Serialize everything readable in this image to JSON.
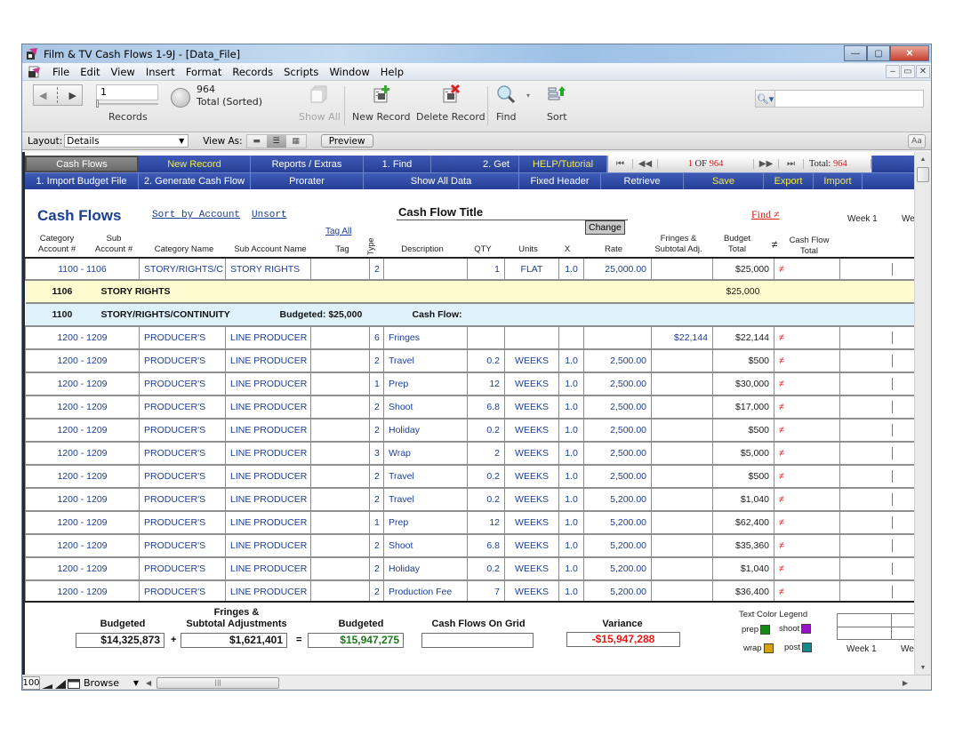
{
  "window": {
    "title": "Film & TV Cash Flows 1-9J - [Data_File]",
    "controls": {
      "minimize": "—",
      "maximize": "▢",
      "close": "✕"
    }
  },
  "menu": [
    "File",
    "Edit",
    "View",
    "Insert",
    "Format",
    "Records",
    "Scripts",
    "Window",
    "Help"
  ],
  "mdi_controls": {
    "minimize": "–",
    "restore": "🗗",
    "close": "✕"
  },
  "toolbar": {
    "record_value": "1",
    "records_label": "Records",
    "found_count": "964",
    "found_status": "Total (Sorted)",
    "show_all": "Show All",
    "new_record": "New Record",
    "delete_record": "Delete Record",
    "find": "Find",
    "sort": "Sort",
    "quick_find_placeholder": ""
  },
  "layout_bar": {
    "layout_label": "Layout:",
    "layout_value": "Details",
    "view_as_label": "View As:",
    "preview": "Preview",
    "text_format": "Aa"
  },
  "nav_row1": {
    "cash_flows": "Cash Flows",
    "new_record": "New  Record",
    "reports": "Reports / Extras",
    "find": "1. Find",
    "get": "2. Get",
    "help": "HELP/Tutorial",
    "record_current": "1",
    "record_of": "OF",
    "record_total": "964",
    "total_label": "Total:",
    "total_value": "964"
  },
  "nav_row2": {
    "import_budget": "1. Import Budget File",
    "generate": "2. Generate Cash Flow",
    "prorater": "Prorater",
    "show_all": "Show All Data",
    "fixed_header": "Fixed Header",
    "retrieve": "Retrieve",
    "save": "Save",
    "export": "Export",
    "import": "Import"
  },
  "header": {
    "page_title": "Cash Flows",
    "sort_by_account": "Sort by Account",
    "unsort": "Unsort",
    "cash_flow_title_label": "Cash Flow Title",
    "change": "Change",
    "find_not_equal": "Find ≠",
    "week1": "Week 1",
    "week2_partial": "We",
    "tag_all": "Tag All"
  },
  "columns": {
    "category_account": [
      "Category",
      "Account #"
    ],
    "sub_account": [
      "Sub",
      "Account #"
    ],
    "category_name": "Category Name",
    "sub_account_name": "Sub Account Name",
    "tag": "Tag",
    "type": "Type",
    "description": "Description",
    "qty": "QTY",
    "units": "Units",
    "x": "X",
    "rate": "Rate",
    "fringes": [
      "Fringes &",
      "Subtotal Adj."
    ],
    "budget_total": [
      "Budget",
      "Total"
    ],
    "not_equal": "≠",
    "cash_flow_total": [
      "Cash Flow",
      "Total"
    ]
  },
  "first_row": {
    "account": "1100 - 1106",
    "category": "STORY/RIGHTS/C",
    "sub_name": "STORY RIGHTS",
    "tag": "",
    "type": "2",
    "description": "",
    "qty": "1",
    "units": "FLAT",
    "x": "1.0",
    "rate": "25,000.00",
    "fringes": "",
    "budget_total": "$25,000",
    "ne": "≠"
  },
  "subtotal_yellow": {
    "code": "1106",
    "name": "STORY RIGHTS",
    "amount": "$25,000"
  },
  "subtotal_blue": {
    "code": "1100",
    "name": "STORY/RIGHTS/CONTINUITY",
    "budgeted": "Budgeted:  $25,000",
    "cash_flow": "Cash Flow:"
  },
  "rows": [
    {
      "account": "1200 - 1209",
      "category": "PRODUCER'S",
      "sub_name": "LINE PRODUCER",
      "type": "6",
      "description": "Fringes",
      "qty": "",
      "units": "",
      "x": "",
      "rate": "",
      "fringes": "$22,144",
      "budget_total": "$22,144",
      "ne": "≠"
    },
    {
      "account": "1200 - 1209",
      "category": "PRODUCER'S",
      "sub_name": "LINE PRODUCER",
      "type": "2",
      "description": "Travel",
      "qty": "0.2",
      "units": "WEEKS",
      "x": "1.0",
      "rate": "2,500.00",
      "fringes": "",
      "budget_total": "$500",
      "ne": "≠"
    },
    {
      "account": "1200 - 1209",
      "category": "PRODUCER'S",
      "sub_name": "LINE PRODUCER",
      "type": "1",
      "description": "Prep",
      "qty": "12",
      "units": "WEEKS",
      "x": "1.0",
      "rate": "2,500.00",
      "fringes": "",
      "budget_total": "$30,000",
      "ne": "≠"
    },
    {
      "account": "1200 - 1209",
      "category": "PRODUCER'S",
      "sub_name": "LINE PRODUCER",
      "type": "2",
      "description": "Shoot",
      "qty": "6.8",
      "units": "WEEKS",
      "x": "1.0",
      "rate": "2,500.00",
      "fringes": "",
      "budget_total": "$17,000",
      "ne": "≠"
    },
    {
      "account": "1200 - 1209",
      "category": "PRODUCER'S",
      "sub_name": "LINE PRODUCER",
      "type": "2",
      "description": "Holiday",
      "qty": "0.2",
      "units": "WEEKS",
      "x": "1.0",
      "rate": "2,500.00",
      "fringes": "",
      "budget_total": "$500",
      "ne": "≠"
    },
    {
      "account": "1200 - 1209",
      "category": "PRODUCER'S",
      "sub_name": "LINE PRODUCER",
      "type": "3",
      "description": "Wrap",
      "qty": "2",
      "units": "WEEKS",
      "x": "1.0",
      "rate": "2,500.00",
      "fringes": "",
      "budget_total": "$5,000",
      "ne": "≠"
    },
    {
      "account": "1200 - 1209",
      "category": "PRODUCER'S",
      "sub_name": "LINE PRODUCER",
      "type": "2",
      "description": "Travel",
      "qty": "0.2",
      "units": "WEEKS",
      "x": "1.0",
      "rate": "2,500.00",
      "fringes": "",
      "budget_total": "$500",
      "ne": "≠"
    },
    {
      "account": "1200 - 1209",
      "category": "PRODUCER'S",
      "sub_name": "LINE PRODUCER",
      "type": "2",
      "description": "Travel",
      "qty": "0.2",
      "units": "WEEKS",
      "x": "1.0",
      "rate": "5,200.00",
      "fringes": "",
      "budget_total": "$1,040",
      "ne": "≠"
    },
    {
      "account": "1200 - 1209",
      "category": "PRODUCER'S",
      "sub_name": "LINE PRODUCER",
      "type": "1",
      "description": "Prep",
      "qty": "12",
      "units": "WEEKS",
      "x": "1.0",
      "rate": "5,200.00",
      "fringes": "",
      "budget_total": "$62,400",
      "ne": "≠"
    },
    {
      "account": "1200 - 1209",
      "category": "PRODUCER'S",
      "sub_name": "LINE PRODUCER",
      "type": "2",
      "description": "Shoot",
      "qty": "6.8",
      "units": "WEEKS",
      "x": "1.0",
      "rate": "5,200.00",
      "fringes": "",
      "budget_total": "$35,360",
      "ne": "≠"
    },
    {
      "account": "1200 - 1209",
      "category": "PRODUCER'S",
      "sub_name": "LINE PRODUCER",
      "type": "2",
      "description": "Holiday",
      "qty": "0.2",
      "units": "WEEKS",
      "x": "1.0",
      "rate": "5,200.00",
      "fringes": "",
      "budget_total": "$1,040",
      "ne": "≠"
    },
    {
      "account": "1200 - 1209",
      "category": "PRODUCER'S",
      "sub_name": "LINE PRODUCER",
      "type": "2",
      "description": "Production Fee",
      "qty": "7",
      "units": "WEEKS",
      "x": "1.0",
      "rate": "5,200.00",
      "fringes": "",
      "budget_total": "$36,400",
      "ne": "≠"
    }
  ],
  "footer": {
    "budgeted_label": "Budgeted",
    "budgeted_value": "$14,325,873",
    "plus": "+",
    "fringes_label": [
      "Fringes &",
      "Subtotal Adjustments"
    ],
    "fringes_value": "$1,621,401",
    "equals": "=",
    "budgeted_total_label": "Budgeted",
    "budgeted_total_value": "$15,947,275",
    "cash_flows_grid_label": "Cash Flows On Grid",
    "cash_flows_grid_value": "",
    "variance_label": "Variance",
    "variance_value": "-$15,947,288",
    "legend_title": "Text Color Legend",
    "legend": [
      {
        "label": "prep",
        "color": "#148a14"
      },
      {
        "label": "shoot",
        "color": "#9a12c8"
      },
      {
        "label": "wrap",
        "color": "#d4a20c"
      },
      {
        "label": "post",
        "color": "#118a8a"
      }
    ],
    "week1": "Week 1",
    "week2_partial": "We"
  },
  "status_bar": {
    "zoom": "100",
    "mode": "Browse"
  },
  "colors": {
    "nav_blue": "#2d47a3",
    "link_blue": "#1c3e94",
    "alert_red": "#e11818",
    "highlight_yellow": "#f4e94a",
    "total_green": "#1a7a1a"
  }
}
